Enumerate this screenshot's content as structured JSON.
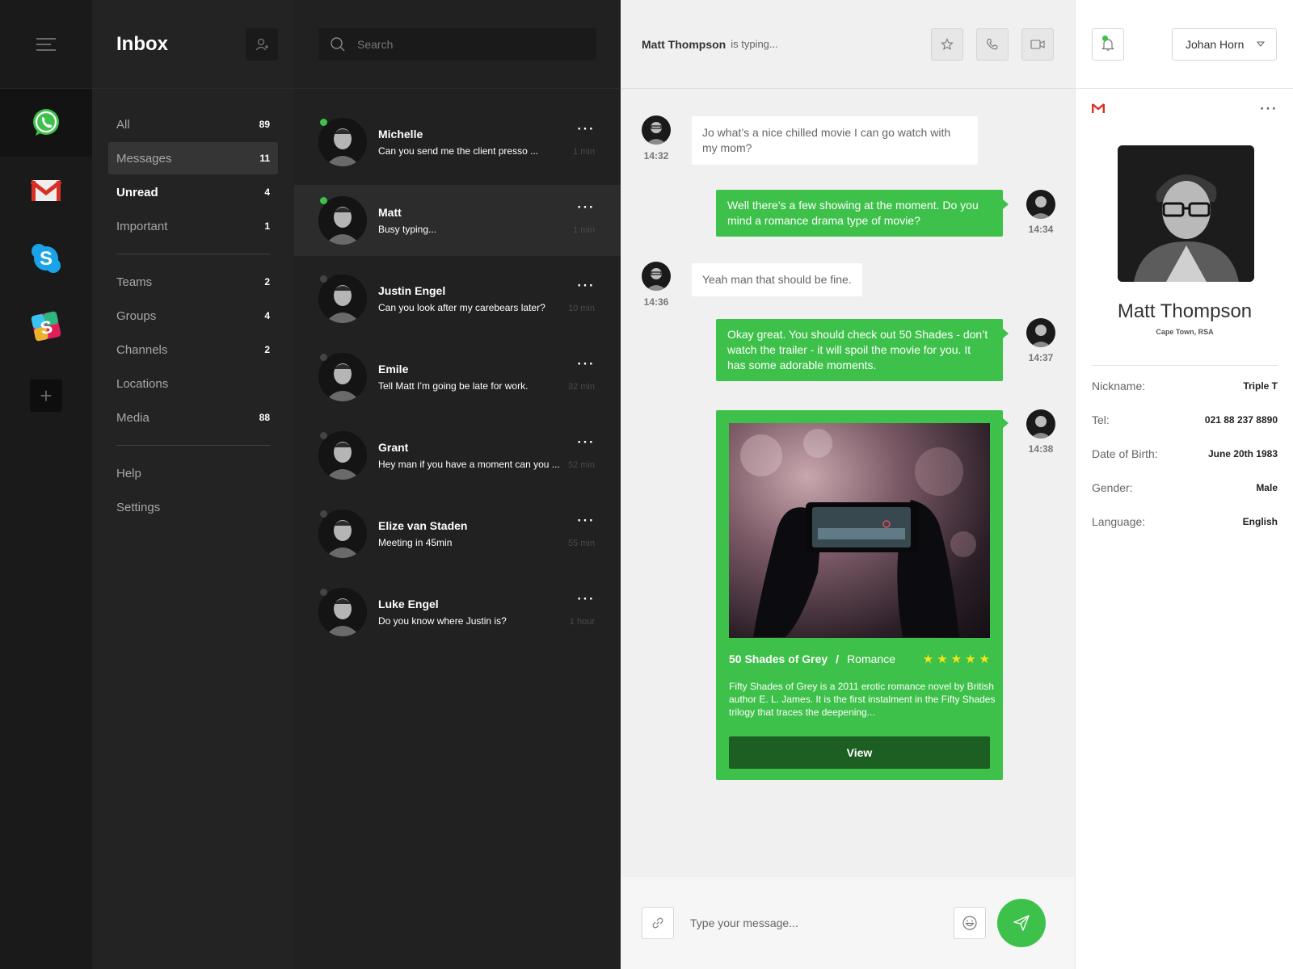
{
  "rail": {
    "apps": [
      {
        "name": "whatsapp-icon"
      },
      {
        "name": "gmail-icon"
      },
      {
        "name": "skype-icon"
      },
      {
        "name": "slack-icon"
      }
    ],
    "add_label": "+"
  },
  "folders": {
    "title": "Inbox",
    "group1": [
      {
        "label": "All",
        "count": "89"
      },
      {
        "label": "Messages",
        "count": "11"
      },
      {
        "label": "Unread",
        "count": "4"
      },
      {
        "label": "Important",
        "count": "1"
      }
    ],
    "group2": [
      {
        "label": "Teams",
        "count": "2"
      },
      {
        "label": "Groups",
        "count": "4"
      },
      {
        "label": "Channels",
        "count": "2"
      },
      {
        "label": "Locations",
        "count": ""
      },
      {
        "label": "Media",
        "count": "88"
      }
    ],
    "group3": [
      {
        "label": "Help"
      },
      {
        "label": "Settings"
      }
    ]
  },
  "search": {
    "placeholder": "Search"
  },
  "conversations": [
    {
      "name": "Michelle",
      "preview": "Can you send me the client presso ...",
      "time": "1 min",
      "online": true
    },
    {
      "name": "Matt",
      "preview": "Busy typing...",
      "time": "1 min",
      "online": true
    },
    {
      "name": "Justin Engel",
      "preview": "Can you look after my carebears later?",
      "time": "10 min",
      "online": false
    },
    {
      "name": "Emile",
      "preview": "Tell Matt I’m going be late for work.",
      "time": "32 min",
      "online": false
    },
    {
      "name": "Grant",
      "preview": "Hey man if you have a moment can you ...",
      "time": "52 min",
      "online": false
    },
    {
      "name": "Elize van Staden",
      "preview": "Meeting in 45min",
      "time": "55 min",
      "online": false
    },
    {
      "name": "Luke Engel",
      "preview": "Do you know where Justin is?",
      "time": "1 hour",
      "online": false
    }
  ],
  "chat": {
    "contact_name": "Matt  Thompson",
    "status": "is typing...",
    "messages": [
      {
        "direction": "in",
        "text": "Jo what’s a nice chilled movie I can go watch with my mom?",
        "time": "14:32"
      },
      {
        "direction": "out",
        "text": "Well there’s a few showing at the moment. Do you mind a romance drama type of movie?",
        "time": "14:34"
      },
      {
        "direction": "in",
        "text": "Yeah man that should be fine.",
        "time": "14:36"
      },
      {
        "direction": "out",
        "text": "Okay great. You should check out 50 Shades - don’t watch the trailer - it will spoil the movie for you. It has some adorable moments.",
        "time": "14:37"
      }
    ],
    "card": {
      "time": "14:38",
      "title": "50 Shades of Grey",
      "separator": "/",
      "genre": "Romance",
      "rating": 5,
      "description": "Fifty Shades of Grey is a 2011 erotic romance novel by British author E. L. James. It is the first instalment in the Fifty Shades trilogy that traces the deepening...",
      "button": "View"
    },
    "composer_placeholder": "Type your message..."
  },
  "profile": {
    "user_select": "Johan Horn",
    "name": "Matt Thompson",
    "location": "Cape Town, RSA",
    "details": [
      {
        "label": "Nickname:",
        "value": "Triple T"
      },
      {
        "label": "Tel:",
        "value": "021 88 237 8890"
      },
      {
        "label": "Date of Birth:",
        "value": "June 20th 1983"
      },
      {
        "label": "Gender:",
        "value": "Male"
      },
      {
        "label": "Language:",
        "value": "English"
      }
    ]
  },
  "colors": {
    "accent_green": "#3ec14a",
    "dark_green": "#1d5e22",
    "star_yellow": "#f6e21a",
    "gmail_red": "#d93025"
  }
}
